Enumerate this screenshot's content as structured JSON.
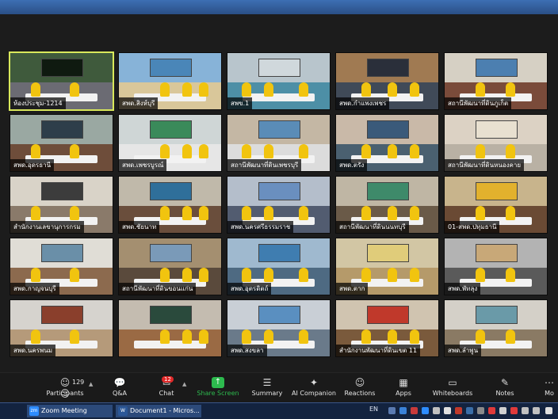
{
  "meeting": {
    "tiles": [
      {
        "label": "ห้องประชุม-1214",
        "active": true,
        "wall": "#3f5a3c",
        "floor": "#6b6b73",
        "screen": "#0f1a10"
      },
      {
        "label": "สพด.สิงห์บุรี",
        "active": false,
        "wall": "#87b3d8",
        "floor": "#d9c79a",
        "screen": "#4a86b8"
      },
      {
        "label": "สพข.1",
        "active": false,
        "wall": "#b8c5cc",
        "floor": "#4d8fa6",
        "screen": "#d0d8dc"
      },
      {
        "label": "สพด.กำแพงเพชร",
        "active": false,
        "wall": "#a07a52",
        "floor": "#404a58",
        "screen": "#2a2f3a"
      },
      {
        "label": "สถานีพัฒนาที่ดินภูเก็ต",
        "active": false,
        "wall": "#d6d0c4",
        "floor": "#7a4b3a",
        "screen": "#4c7fb0"
      },
      {
        "label": "สพด.อุดรธานี",
        "active": false,
        "wall": "#9aa8a2",
        "floor": "#6e4d3a",
        "screen": "#2e3e4a"
      },
      {
        "label": "สพด.เพชรบูรณ์",
        "active": false,
        "wall": "#cfd6d6",
        "floor": "#e6e6e6",
        "screen": "#3a8a5a"
      },
      {
        "label": "สถานีพัฒนาที่ดินเพชรบุรี",
        "active": false,
        "wall": "#c4b7a4",
        "floor": "#dcdcdc",
        "screen": "#5a8cb7"
      },
      {
        "label": "สพด.ตรัง",
        "active": false,
        "wall": "#c9b9a8",
        "floor": "#4a6070",
        "screen": "#3a5a7a"
      },
      {
        "label": "สถานีพัฒนาที่ดินหนองคาย",
        "active": false,
        "wall": "#dcd2c4",
        "floor": "#b9b1a4",
        "screen": "#e8e0d0"
      },
      {
        "label": "สำนักงานเลขานุการกรม",
        "active": false,
        "wall": "#d9d3c8",
        "floor": "#8a7a6a",
        "screen": "#3c3c3c"
      },
      {
        "label": "สพด.ชัยนาท",
        "active": false,
        "wall": "#c0b9aa",
        "floor": "#6a4e3c",
        "screen": "#2f6f9a"
      },
      {
        "label": "สพด.นครศรีธรรมราช",
        "active": false,
        "wall": "#b4becb",
        "floor": "#525c70",
        "screen": "#6a8fbf"
      },
      {
        "label": "สถานีพัฒนาที่ดินนนทบุรี",
        "active": false,
        "wall": "#bfb6a4",
        "floor": "#6a5a48",
        "screen": "#3e8a6a"
      },
      {
        "label": "01-สพด.ปทุมธานี",
        "active": false,
        "wall": "#c8b48c",
        "floor": "#6a4a34",
        "screen": "#e2b12d"
      },
      {
        "label": "สพด.กาญจนบุรี",
        "active": false,
        "wall": "#e0ddd6",
        "floor": "#8c6a4e",
        "screen": "#6a8fa8"
      },
      {
        "label": "สถานีพัฒนาที่ดินขอนแก่น",
        "active": false,
        "wall": "#a48f70",
        "floor": "#5a4a3c",
        "screen": "#7a9ab8"
      },
      {
        "label": "สพด.อุตรดิตถ์",
        "active": false,
        "wall": "#9fb9cf",
        "floor": "#4e6a82",
        "screen": "#3f7db0"
      },
      {
        "label": "สพด.ตาก",
        "active": false,
        "wall": "#d2c6a4",
        "floor": "#b59a6a",
        "screen": "#e0cc7a"
      },
      {
        "label": "สพด.พัทลุง",
        "active": false,
        "wall": "#b3b3b3",
        "floor": "#5a5a5a",
        "screen": "#c8a878"
      },
      {
        "label": "สพด.นครพนม",
        "active": false,
        "wall": "#d6d3ce",
        "floor": "#b59a7a",
        "screen": "#8a3f2c"
      },
      {
        "label": "",
        "active": false,
        "wall": "#c4bcb0",
        "floor": "#9a6a44",
        "screen": "#2a4a3c"
      },
      {
        "label": "สพด.สงขลา",
        "active": false,
        "wall": "#c9cfd6",
        "floor": "#6a7a8a",
        "screen": "#5a8fc0"
      },
      {
        "label": "สำนักงานพัฒนาที่ดินเขต 11",
        "active": false,
        "wall": "#d0c4b0",
        "floor": "#7a5a3c",
        "screen": "#c0392b"
      },
      {
        "label": "สพด.ลำพูน",
        "active": false,
        "wall": "#d4d0c8",
        "floor": "#8a7a64",
        "screen": "#6a9aa8"
      }
    ]
  },
  "toolbar": {
    "participants_count": "129",
    "participants_label": "Participants",
    "qa_label": "Q&A",
    "chat_badge": "12",
    "chat_label": "Chat",
    "share_label": "Share Screen",
    "summary_label": "Summary",
    "ai_label": "AI Companion",
    "reactions_label": "Reactions",
    "apps_label": "Apps",
    "whiteboards_label": "Whiteboards",
    "notes_label": "Notes",
    "more_label": "Mo"
  },
  "taskbar": {
    "zoom_label": "Zoom Meeting",
    "word_label": "Document1 - Micros...",
    "lang": "EN"
  },
  "colors": {
    "share_green": "#2dba4e",
    "badge_red": "#e02828",
    "active_outline": "#d9e85b"
  }
}
